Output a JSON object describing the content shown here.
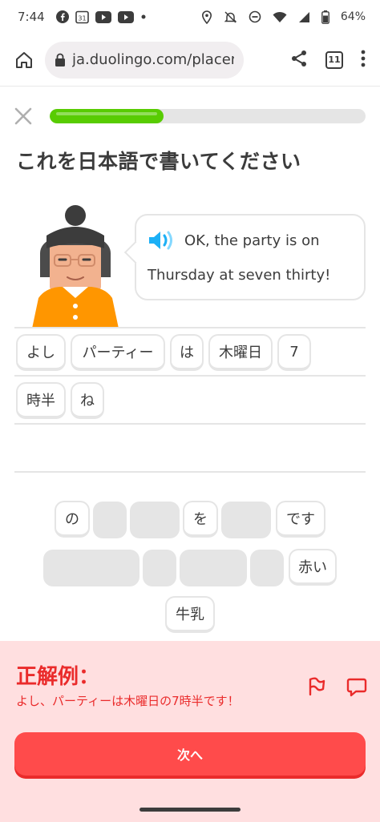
{
  "status_bar": {
    "time": "7:44",
    "battery_percent": "64%",
    "icons": [
      "facebook-icon",
      "calendar-icon",
      "youtube-icon",
      "youtube-icon",
      "dot-icon",
      "location-icon",
      "mute-icon",
      "dnd-icon",
      "wifi-icon",
      "signal-icon",
      "battery-icon"
    ],
    "calendar_date": "31"
  },
  "browser": {
    "url": "ja.duolingo.com/placem",
    "tab_count": "11"
  },
  "lesson": {
    "progress_fraction": 0.36,
    "prompt_title": "これを日本語で書いてください",
    "speech_line1": "OK, the party is on",
    "speech_line2": "Thursday at seven thirty!"
  },
  "answer_tiles": [
    {
      "label": "よし"
    },
    {
      "label": "パーティー"
    },
    {
      "label": "は"
    },
    {
      "label": "木曜日"
    },
    {
      "label": "7"
    },
    {
      "label": "時半"
    },
    {
      "label": "ね"
    }
  ],
  "word_bank": [
    {
      "label": "の"
    },
    {
      "label": "を"
    },
    {
      "label": "です"
    },
    {
      "label": "赤い"
    },
    {
      "label": "牛乳"
    }
  ],
  "feedback": {
    "title": "正解例：",
    "answer": "よし、パーティーは木曜日の7時半です！",
    "next_label": "次へ"
  },
  "colors": {
    "progress_green": "#58cc02",
    "feedback_bg": "#ffdfe0",
    "feedback_red": "#ea2b2b",
    "button_red": "#ff4b4b",
    "speaker_blue": "#1cb0f6"
  }
}
